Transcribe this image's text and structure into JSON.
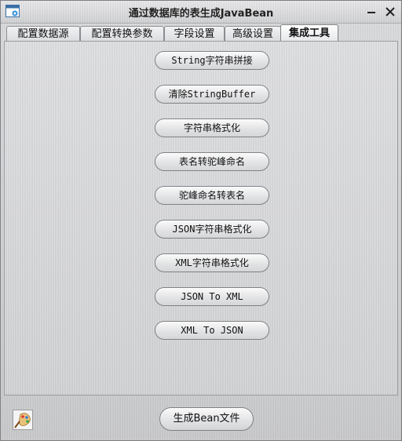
{
  "window": {
    "title": "通过数据库的表生成JavaBean"
  },
  "tabs": [
    {
      "label": "配置数据源",
      "active": false
    },
    {
      "label": "配置转换参数",
      "active": false
    },
    {
      "label": "字段设置",
      "active": false
    },
    {
      "label": "高级设置",
      "active": false
    },
    {
      "label": "集成工具",
      "active": true
    }
  ],
  "tools": [
    {
      "label": "String字符串拼接"
    },
    {
      "label": "清除StringBuffer"
    },
    {
      "label": "字符串格式化"
    },
    {
      "label": "表名转驼峰命名"
    },
    {
      "label": "驼峰命名转表名"
    },
    {
      "label": "JSON字符串格式化"
    },
    {
      "label": "XML字符串格式化"
    },
    {
      "label": "JSON To XML"
    },
    {
      "label": "XML To JSON"
    }
  ],
  "footer": {
    "generate_label": "生成Bean文件"
  },
  "icons": {
    "app": "window-app-icon",
    "bottom": "paint-palette-icon",
    "minimize": "minimize-icon",
    "close": "close-icon"
  },
  "colors": {
    "active_tab_accent": "#e8b45c",
    "border": "#7f8184"
  }
}
